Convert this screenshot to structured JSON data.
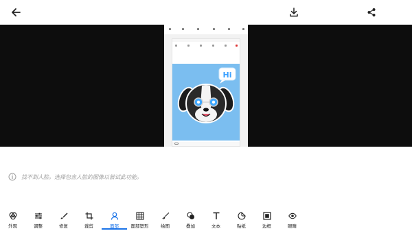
{
  "topbar": {
    "back_icon": "arrow-left-icon",
    "download_icon": "download-icon",
    "share_icon": "share-icon"
  },
  "preview": {
    "sticker_text": "Hi"
  },
  "notice": {
    "icon": "info-icon",
    "text": "找不到人脸。选择包含人脸的图像以尝试此功能。"
  },
  "tools": [
    {
      "label": "外观",
      "icon": "appearance-icon"
    },
    {
      "label": "调整",
      "icon": "sliders-icon"
    },
    {
      "label": "修复",
      "icon": "brush-icon"
    },
    {
      "label": "裁剪",
      "icon": "crop-icon"
    },
    {
      "label": "面部",
      "icon": "face-icon",
      "active": true
    },
    {
      "label": "面部塑形",
      "icon": "face-grid-icon"
    },
    {
      "label": "绘图",
      "icon": "draw-icon"
    },
    {
      "label": "叠加",
      "icon": "overlay-icon"
    },
    {
      "label": "文本",
      "icon": "text-icon"
    },
    {
      "label": "贴纸",
      "icon": "sticker-icon"
    },
    {
      "label": "边框",
      "icon": "frame-icon"
    },
    {
      "label": "眼睛",
      "icon": "eye-icon"
    }
  ],
  "colors": {
    "accent": "#1a73e8",
    "preview_bg": "#0d0d0d",
    "sticker_bg": "#7bbef0"
  }
}
